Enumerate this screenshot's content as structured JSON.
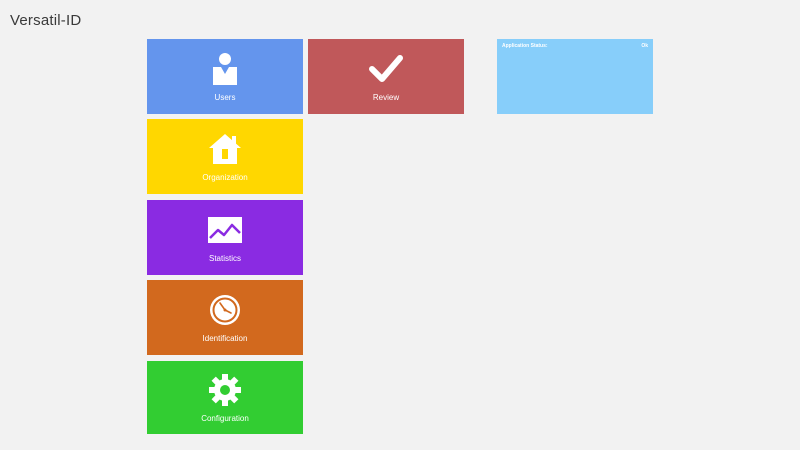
{
  "app": {
    "title": "Versatil-ID"
  },
  "tiles": [
    {
      "id": "users",
      "label": "Users",
      "icon": "user-icon",
      "color": "#6495ed"
    },
    {
      "id": "review",
      "label": "Review",
      "icon": "checkmark-icon",
      "color": "#c0585a"
    },
    {
      "id": "organization",
      "label": "Organization",
      "icon": "house-icon",
      "color": "#ffd700"
    },
    {
      "id": "statistics",
      "label": "Statistics",
      "icon": "chart-icon",
      "color": "#8a2be2"
    },
    {
      "id": "identification",
      "label": "Identification",
      "icon": "clock-icon",
      "color": "#d2691e"
    },
    {
      "id": "configuration",
      "label": "Configuration",
      "icon": "gear-icon",
      "color": "#32cd32"
    }
  ],
  "status": {
    "label": "Application Status:",
    "value": "Ok",
    "color": "#87cefa"
  }
}
